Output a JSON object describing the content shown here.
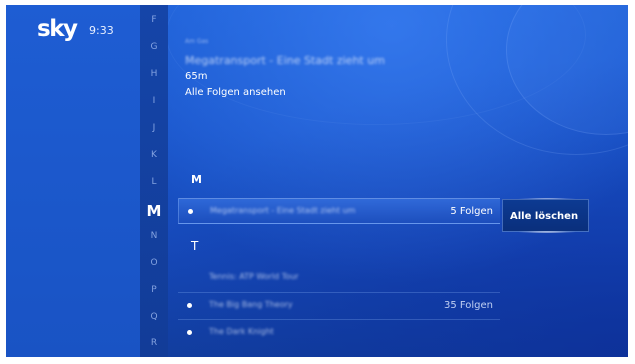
{
  "header": {
    "logo": "sky",
    "time": "9:33"
  },
  "alphabet": {
    "letters": [
      "F",
      "G",
      "H",
      "I",
      "J",
      "K",
      "L",
      "M",
      "N",
      "O",
      "P",
      "Q",
      "R"
    ],
    "active": "M"
  },
  "detail": {
    "meta": "Am Gas",
    "title": "Megatransport - Eine Stadt zieht um",
    "duration": "65m",
    "all_episodes": "Alle Folgen ansehen"
  },
  "list": {
    "section_m": "M",
    "section_t": "T",
    "row_m1": {
      "title": "Megatransport - Eine Stadt zieht um",
      "count": "5 Folgen"
    },
    "row_t1": {
      "title": "Tennis: ATP World Tour"
    },
    "row_t2": {
      "title": "The Big Bang Theory",
      "count": "35 Folgen"
    },
    "row_t3": {
      "title": "The Dark Knight"
    }
  },
  "actions": {
    "delete_all": "Alle löschen"
  }
}
